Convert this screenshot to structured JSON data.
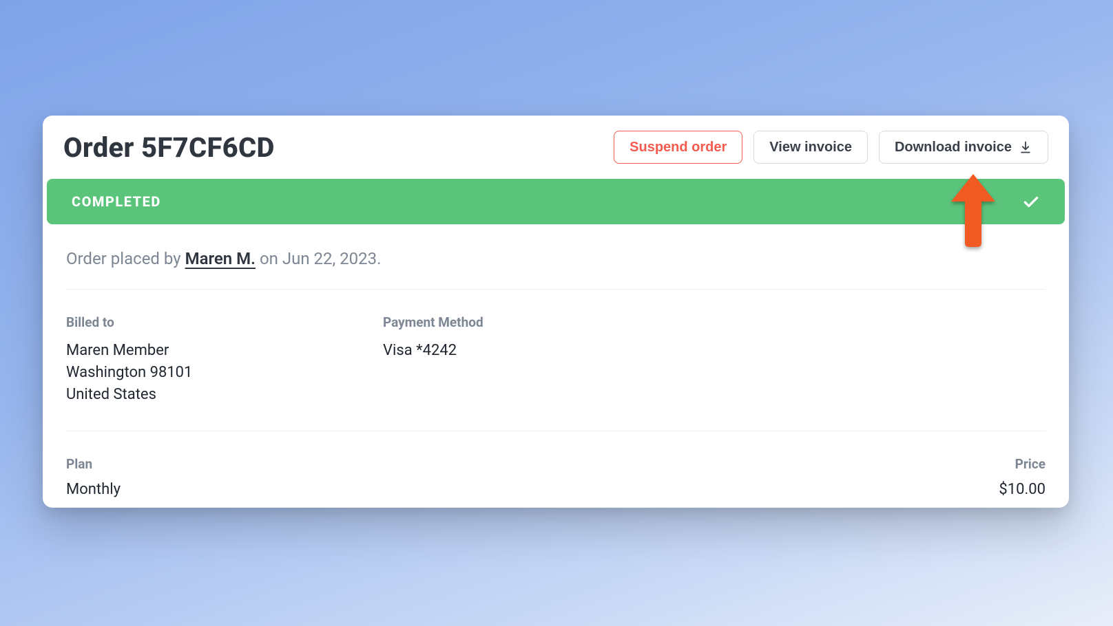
{
  "header": {
    "title": "Order 5F7CF6CD",
    "suspend_label": "Suspend order",
    "view_invoice_label": "View invoice",
    "download_invoice_label": "Download invoice"
  },
  "status": {
    "label": "COMPLETED"
  },
  "placed": {
    "prefix": "Order placed by ",
    "name": "Maren M.",
    "mid": " on ",
    "date": "Jun 22, 2023",
    "suffix": "."
  },
  "billing": {
    "label": "Billed to",
    "name": "Maren Member",
    "city_zip": "Washington 98101",
    "country": "United States"
  },
  "payment": {
    "label": "Payment Method",
    "value": "Visa *4242"
  },
  "plan": {
    "label": "Plan",
    "value": "Monthly"
  },
  "price": {
    "label": "Price",
    "value": "$10.00"
  },
  "colors": {
    "accent_green": "#5bc47b",
    "danger": "#f45b4f",
    "annotation": "#f15a24"
  }
}
